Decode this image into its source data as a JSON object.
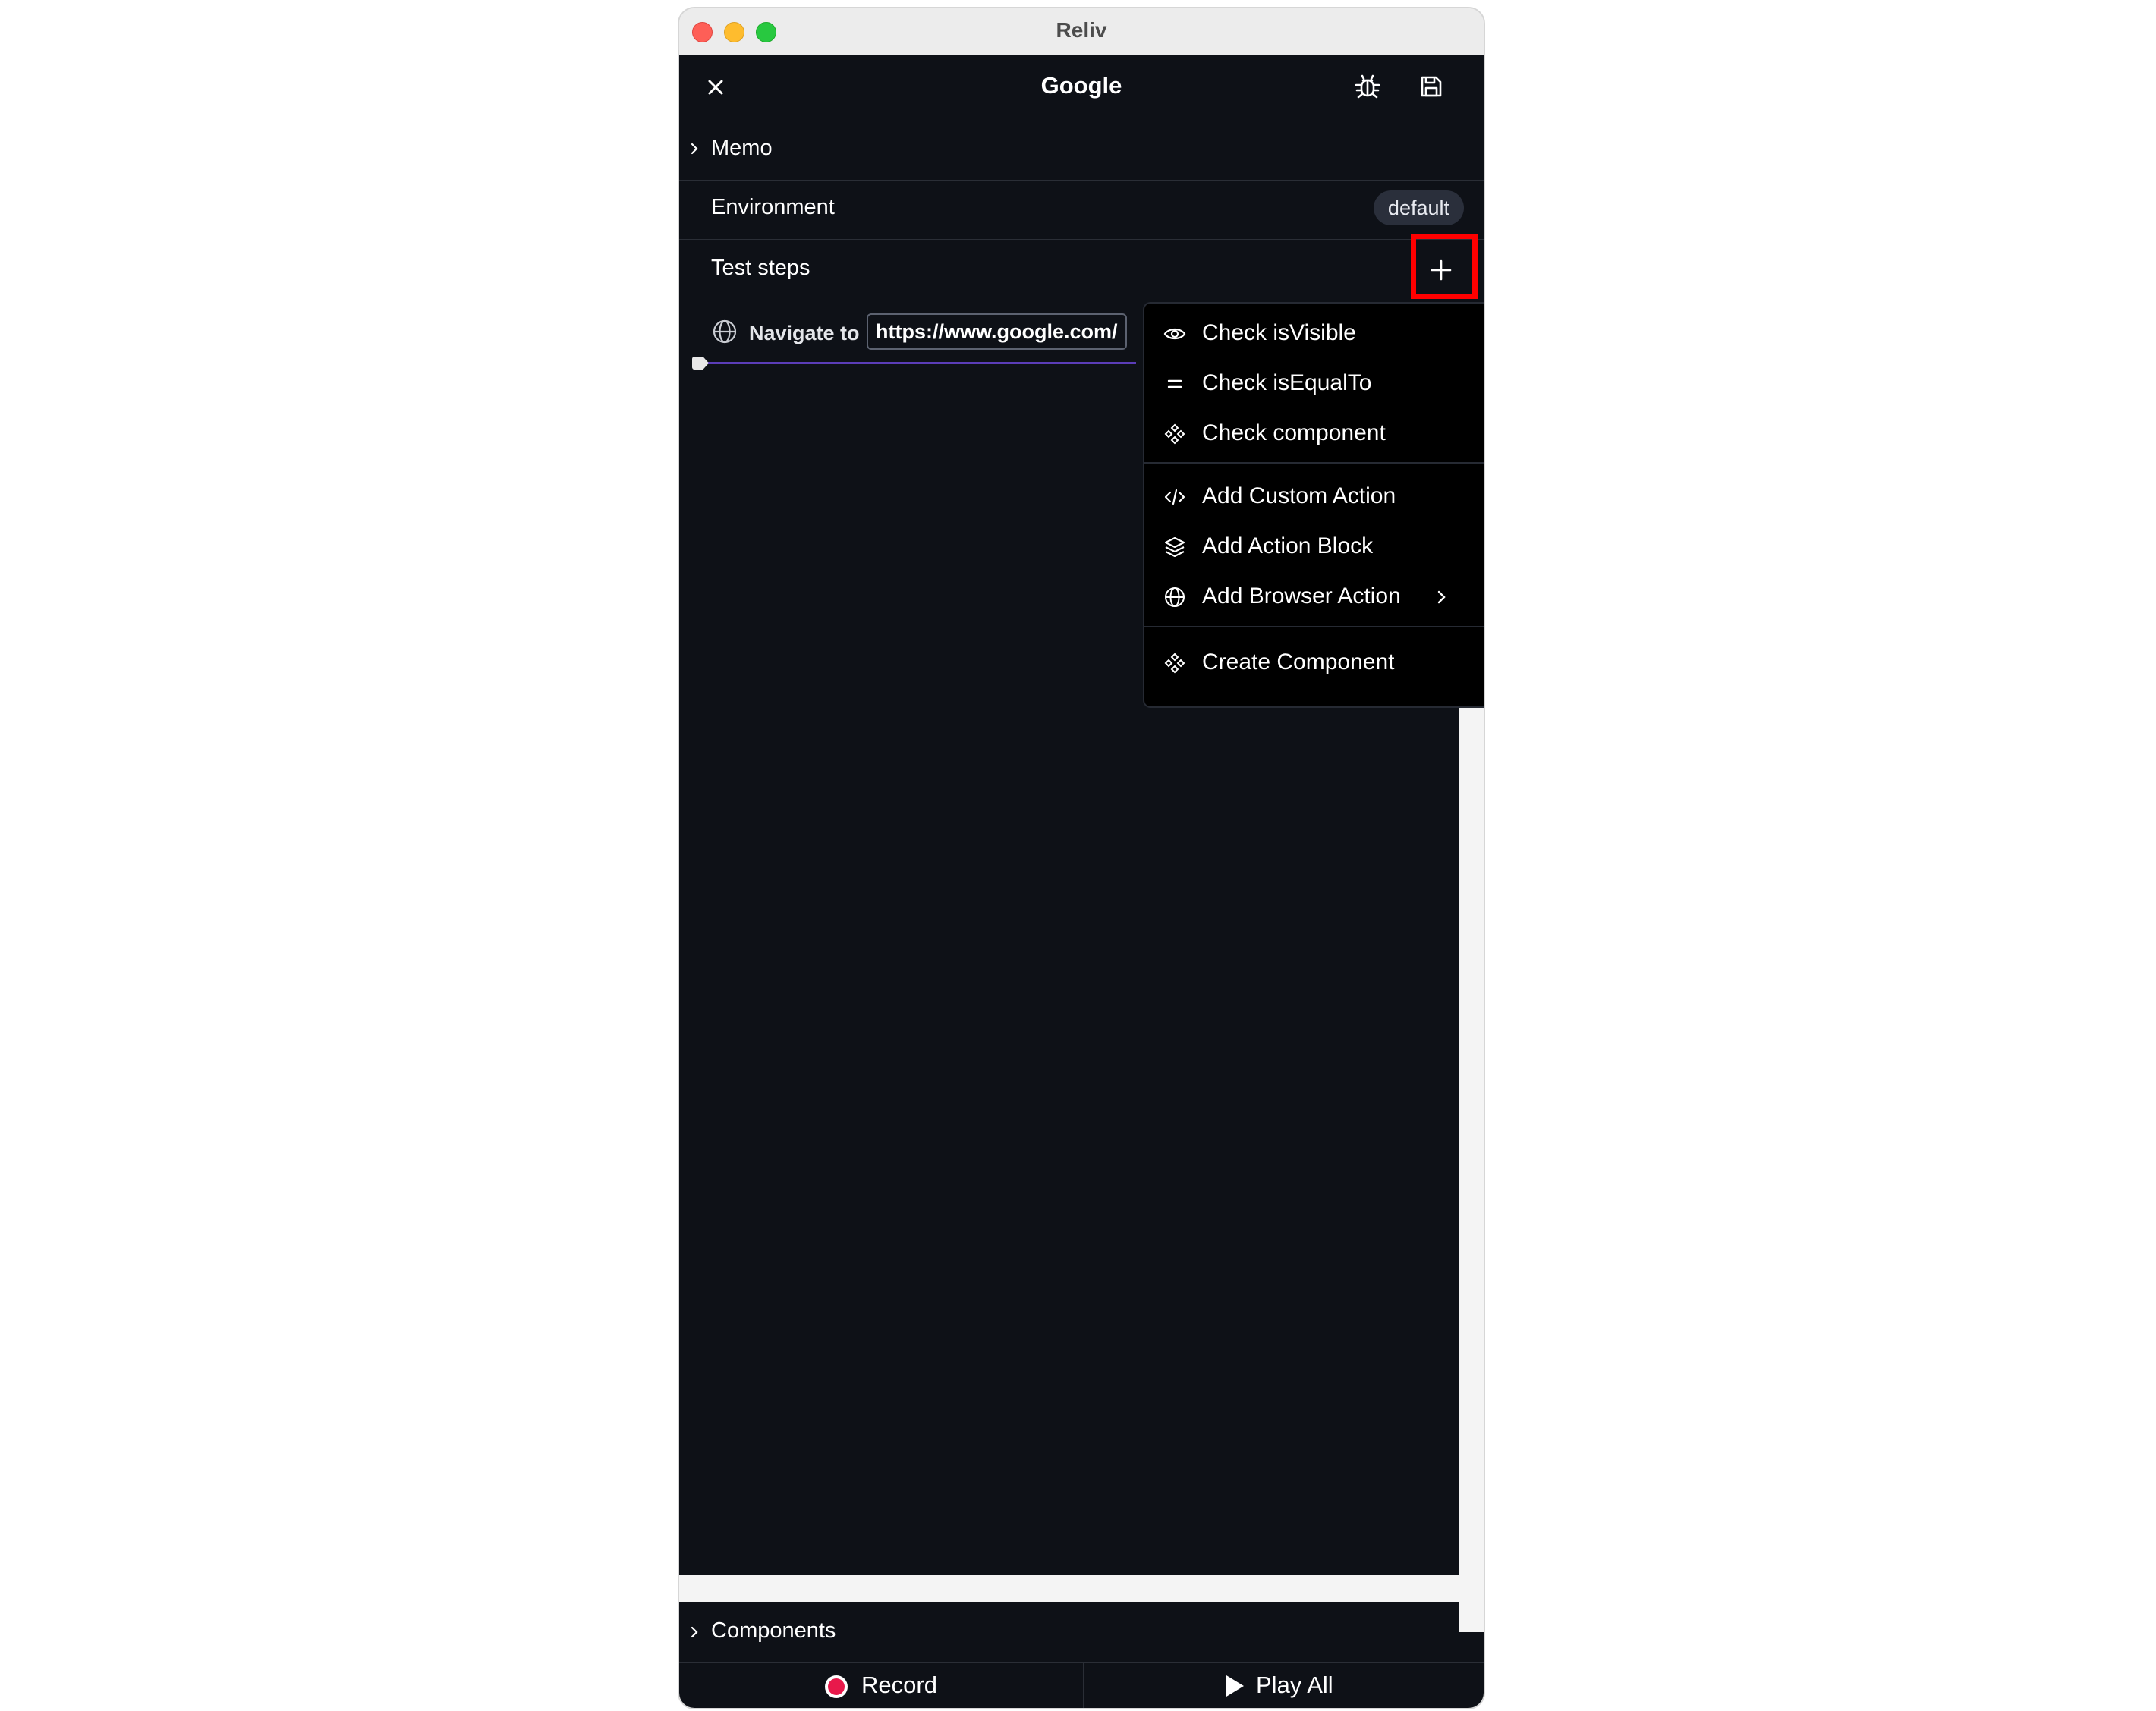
{
  "window": {
    "title": "Reliv"
  },
  "header": {
    "title": "Google",
    "close_icon": "close-icon",
    "debug_icon": "bug-icon",
    "save_icon": "save-icon"
  },
  "memo": {
    "label": "Memo"
  },
  "environment": {
    "label": "Environment",
    "value": "default"
  },
  "test_steps": {
    "label": "Test steps",
    "add_icon": "plus-icon",
    "steps": [
      {
        "action": "Navigate to",
        "url": "https://www.google.com/"
      }
    ]
  },
  "add_menu": {
    "items": [
      {
        "label": "Check isVisible",
        "icon": "eye-icon"
      },
      {
        "label": "Check isEqualTo",
        "icon": "equals-icon"
      },
      {
        "label": "Check component",
        "icon": "component-icon"
      },
      {
        "label": "Add Custom Action",
        "icon": "code-icon"
      },
      {
        "label": "Add Action Block",
        "icon": "layers-icon"
      },
      {
        "label": "Add Browser Action",
        "icon": "globe-icon",
        "submenu": true
      },
      {
        "label": "Create Component",
        "icon": "component-icon"
      }
    ]
  },
  "components": {
    "label": "Components"
  },
  "footer": {
    "record_label": "Record",
    "play_label": "Play All"
  },
  "colors": {
    "background": "#0e1117",
    "menu_bg": "#000000",
    "highlight": "#ff0000",
    "record": "#e8194b",
    "timeline": "#5b3db8"
  }
}
